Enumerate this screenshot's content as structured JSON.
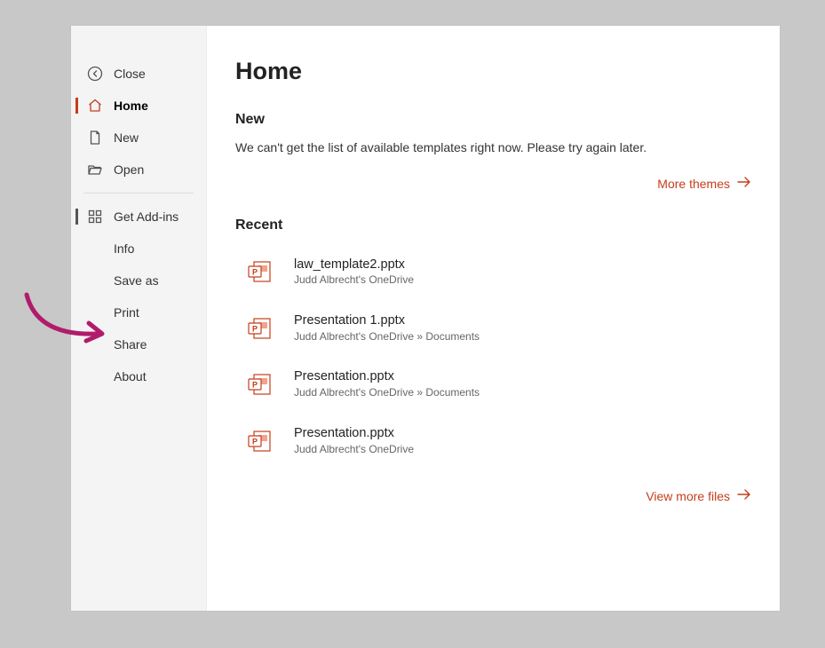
{
  "sidebar": {
    "close": "Close",
    "home": "Home",
    "new": "New",
    "open": "Open",
    "addins": "Get Add-ins",
    "info": "Info",
    "saveas": "Save as",
    "print": "Print",
    "share": "Share",
    "about": "About"
  },
  "colors": {
    "accent": "#c43e1c"
  },
  "main": {
    "title": "Home",
    "new_heading": "New",
    "template_message": "We can't get the list of available templates right now. Please try again later.",
    "more_themes": "More themes",
    "recent_heading": "Recent",
    "view_more": "View more files"
  },
  "recent_files": [
    {
      "name": "law_template2.pptx",
      "location": "Judd Albrecht's OneDrive"
    },
    {
      "name": "Presentation 1.pptx",
      "location": "Judd Albrecht's OneDrive » Documents"
    },
    {
      "name": "Presentation.pptx",
      "location": "Judd Albrecht's OneDrive » Documents"
    },
    {
      "name": "Presentation.pptx",
      "location": "Judd Albrecht's OneDrive"
    }
  ]
}
